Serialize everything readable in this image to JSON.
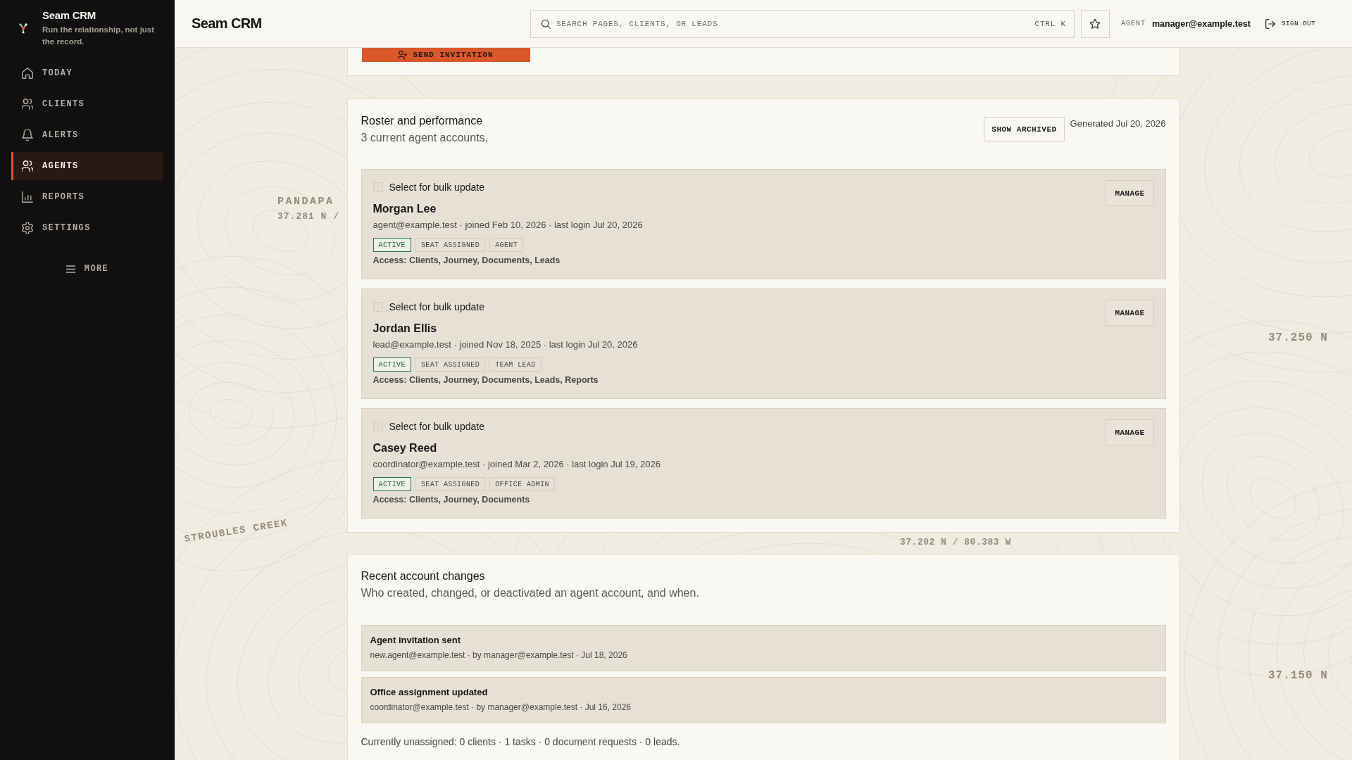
{
  "sidebar": {
    "brand": {
      "title": "Seam CRM",
      "tagline": "Run the relationship, not just the record."
    },
    "nav": [
      {
        "label": "TODAY",
        "selected": false
      },
      {
        "label": "CLIENTS",
        "selected": false
      },
      {
        "label": "ALERTS",
        "selected": false
      },
      {
        "label": "AGENTS",
        "selected": true
      },
      {
        "label": "REPORTS",
        "selected": false
      },
      {
        "label": "SETTINGS",
        "selected": false
      }
    ],
    "more": "MORE"
  },
  "topbar": {
    "title": "Seam CRM",
    "search": {
      "placeholder": "SEARCH PAGES, CLIENTS, OR LEADS",
      "shortcut": "CTRL K"
    },
    "user": {
      "role": "AGENT",
      "email": "manager@example.test"
    },
    "sign_out": "SIGN OUT"
  },
  "invite_panel": {
    "button": "SEND INVITATION"
  },
  "roster": {
    "title": "Roster and performance",
    "subtitle": "3 current agent accounts.",
    "show_archived": "SHOW ARCHIVED",
    "generated": "Generated Jul 20, 2026",
    "agents": [
      {
        "select_label": "Select for bulk update",
        "checked": false,
        "name": "Morgan Lee",
        "meta": "agent@example.test · joined Feb 10, 2026 · last login Jul 20, 2026",
        "badges": [
          {
            "label": "ACTIVE",
            "kind": "status"
          },
          {
            "label": "SEAT ASSIGNED",
            "kind": "tag"
          },
          {
            "label": "AGENT",
            "kind": "tag"
          }
        ],
        "access": "Access: Clients, Journey, Documents, Leads",
        "action": "MANAGE"
      },
      {
        "select_label": "Select for bulk update",
        "checked": false,
        "name": "Jordan Ellis",
        "meta": "lead@example.test · joined Nov 18, 2025 · last login Jul 20, 2026",
        "badges": [
          {
            "label": "ACTIVE",
            "kind": "status"
          },
          {
            "label": "SEAT ASSIGNED",
            "kind": "tag"
          },
          {
            "label": "TEAM LEAD",
            "kind": "tag"
          }
        ],
        "access": "Access: Clients, Journey, Documents, Leads, Reports",
        "action": "MANAGE"
      },
      {
        "select_label": "Select for bulk update",
        "checked": false,
        "name": "Casey Reed",
        "meta": "coordinator@example.test · joined Mar 2, 2026 · last login Jul 19, 2026",
        "badges": [
          {
            "label": "ACTIVE",
            "kind": "status"
          },
          {
            "label": "SEAT ASSIGNED",
            "kind": "tag"
          },
          {
            "label": "OFFICE ADMIN",
            "kind": "tag"
          }
        ],
        "access": "Access: Clients, Journey, Documents",
        "action": "MANAGE"
      }
    ]
  },
  "changes": {
    "title": "Recent account changes",
    "subtitle": "Who created, changed, or deactivated an agent account, and when.",
    "items": [
      {
        "title": "Agent invitation sent",
        "meta": "new.agent@example.test · by manager@example.test · Jul 18, 2026"
      },
      {
        "title": "Office assignment updated",
        "meta": "coordinator@example.test · by manager@example.test · Jul 16, 2026"
      }
    ],
    "footer": "Currently unassigned: 0 clients · 1 tasks · 0 document requests · 0 leads."
  },
  "map_labels": [
    "PANDAPA",
    "37.281 N /",
    "37.250 N",
    "STROUBLES CREEK",
    "37.202 N / 80.383 W",
    "37.150 N"
  ]
}
